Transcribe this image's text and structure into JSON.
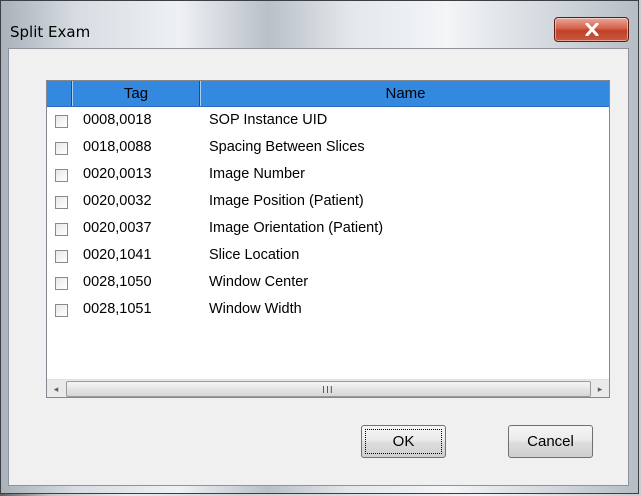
{
  "window": {
    "title": "Split Exam"
  },
  "icons": {
    "close": "close-x-icon"
  },
  "list": {
    "columns": {
      "check": "",
      "tag": "Tag",
      "name": "Name"
    },
    "rows": [
      {
        "tag": "0008,0018",
        "name": "SOP Instance UID",
        "checked": false
      },
      {
        "tag": "0018,0088",
        "name": "Spacing Between Slices",
        "checked": false
      },
      {
        "tag": "0020,0013",
        "name": "Image Number",
        "checked": false
      },
      {
        "tag": "0020,0032",
        "name": "Image Position (Patient)",
        "checked": false
      },
      {
        "tag": "0020,0037",
        "name": "Image Orientation (Patient)",
        "checked": false
      },
      {
        "tag": "0020,1041",
        "name": "Slice Location",
        "checked": false
      },
      {
        "tag": "0028,1050",
        "name": "Window Center",
        "checked": false
      },
      {
        "tag": "0028,1051",
        "name": "Window Width",
        "checked": false
      }
    ],
    "scrollbar": {
      "left_arrow": "◂",
      "right_arrow": "▸",
      "grip": "III"
    }
  },
  "buttons": {
    "ok": "OK",
    "cancel": "Cancel"
  },
  "colors": {
    "header_bg": "#3388e0",
    "close_button": "#c8472e"
  }
}
